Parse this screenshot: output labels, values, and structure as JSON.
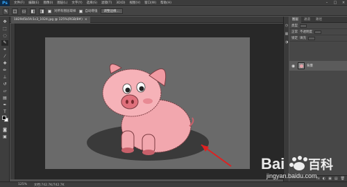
{
  "app": {
    "logo": "Ps"
  },
  "menubar": {
    "items": [
      "文件(F)",
      "编辑(E)",
      "图像(I)",
      "图层(L)",
      "文字(Y)",
      "选择(S)",
      "滤镜(T)",
      "3D(D)",
      "视图(V)",
      "窗口(W)",
      "帮助(H)"
    ],
    "window_controls": [
      "–",
      "□",
      "×"
    ]
  },
  "options": {
    "mode_icons": [
      "□",
      "▭",
      "◧",
      "◨"
    ],
    "sample_all_layers_label": "对所有图层取样",
    "auto_enhance_label": "自动增强",
    "refine_edge_label": "调整边缘..."
  },
  "document": {
    "tab_title": "1829d5b5fc1c3_1024.jpg @ 125%(RGB/8#)",
    "close": "×"
  },
  "status": {
    "zoom": "125%",
    "doc_info": "文档:742.7K/742.7K"
  },
  "layers": {
    "tabs": [
      "图层",
      "通道",
      "路径"
    ],
    "layer_name": "背景",
    "filter_label": "类型",
    "blend_label": "正常",
    "opacity_label": "不透明度",
    "lock_label": "锁定",
    "fill_label": "填充",
    "bottom_icons": [
      "fx",
      "◐",
      "▣",
      "▤",
      "🗑"
    ]
  },
  "watermark": {
    "brand_text": "Bai",
    "brand_text2": "百科",
    "url": "jingyan.baidu.com"
  },
  "colors": {
    "accent": "#31a8ff",
    "pig_body": "#f0a0a8",
    "pig_dark": "#c8606a",
    "shadow": "#3a3a3a",
    "arrow": "#e02020"
  }
}
